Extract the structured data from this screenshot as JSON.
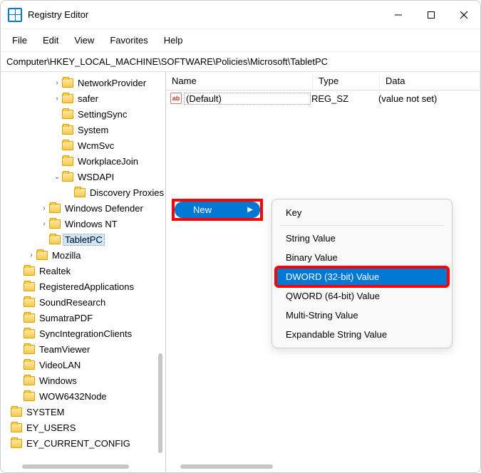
{
  "window": {
    "title": "Registry Editor"
  },
  "menu": {
    "file": "File",
    "edit": "Edit",
    "view": "View",
    "favorites": "Favorites",
    "help": "Help"
  },
  "address": "Computer\\HKEY_LOCAL_MACHINE\\SOFTWARE\\Policies\\Microsoft\\TabletPC",
  "tree": [
    {
      "indent": 4,
      "chev": ">",
      "label": "NetworkProvider"
    },
    {
      "indent": 4,
      "chev": ">",
      "label": "safer"
    },
    {
      "indent": 4,
      "chev": "",
      "label": "SettingSync"
    },
    {
      "indent": 4,
      "chev": "",
      "label": "System"
    },
    {
      "indent": 4,
      "chev": "",
      "label": "WcmSvc"
    },
    {
      "indent": 4,
      "chev": "",
      "label": "WorkplaceJoin"
    },
    {
      "indent": 4,
      "chev": "v",
      "label": "WSDAPI"
    },
    {
      "indent": 5,
      "chev": "",
      "label": "Discovery Proxies"
    },
    {
      "indent": 3,
      "chev": ">",
      "label": "Windows Defender"
    },
    {
      "indent": 3,
      "chev": ">",
      "label": "Windows NT"
    },
    {
      "indent": 3,
      "chev": "",
      "label": "TabletPC",
      "selected": true
    },
    {
      "indent": 2,
      "chev": ">",
      "label": "Mozilla"
    },
    {
      "indent": 1,
      "chev": "",
      "label": "Realtek"
    },
    {
      "indent": 1,
      "chev": "",
      "label": "RegisteredApplications"
    },
    {
      "indent": 1,
      "chev": "",
      "label": "SoundResearch"
    },
    {
      "indent": 1,
      "chev": "",
      "label": "SumatraPDF"
    },
    {
      "indent": 1,
      "chev": "",
      "label": "SyncIntegrationClients"
    },
    {
      "indent": 1,
      "chev": "",
      "label": "TeamViewer"
    },
    {
      "indent": 1,
      "chev": "",
      "label": "VideoLAN"
    },
    {
      "indent": 1,
      "chev": "",
      "label": "Windows"
    },
    {
      "indent": 1,
      "chev": "",
      "label": "WOW6432Node"
    },
    {
      "indent": 0,
      "chev": "",
      "label": "SYSTEM",
      "cut": true
    },
    {
      "indent": 0,
      "chev": "",
      "label": "EY_USERS",
      "cut": true
    },
    {
      "indent": 0,
      "chev": "",
      "label": "EY_CURRENT_CONFIG",
      "cut": true
    }
  ],
  "list": {
    "headers": {
      "name": "Name",
      "type": "Type",
      "data": "Data"
    },
    "rows": [
      {
        "icon": "ab",
        "name": "(Default)",
        "type": "REG_SZ",
        "data": "(value not set)"
      }
    ]
  },
  "context": {
    "new": "New",
    "items": {
      "key": "Key",
      "string": "String Value",
      "binary": "Binary Value",
      "dword": "DWORD (32-bit) Value",
      "qword": "QWORD (64-bit) Value",
      "multi": "Multi-String Value",
      "expand": "Expandable String Value"
    }
  }
}
